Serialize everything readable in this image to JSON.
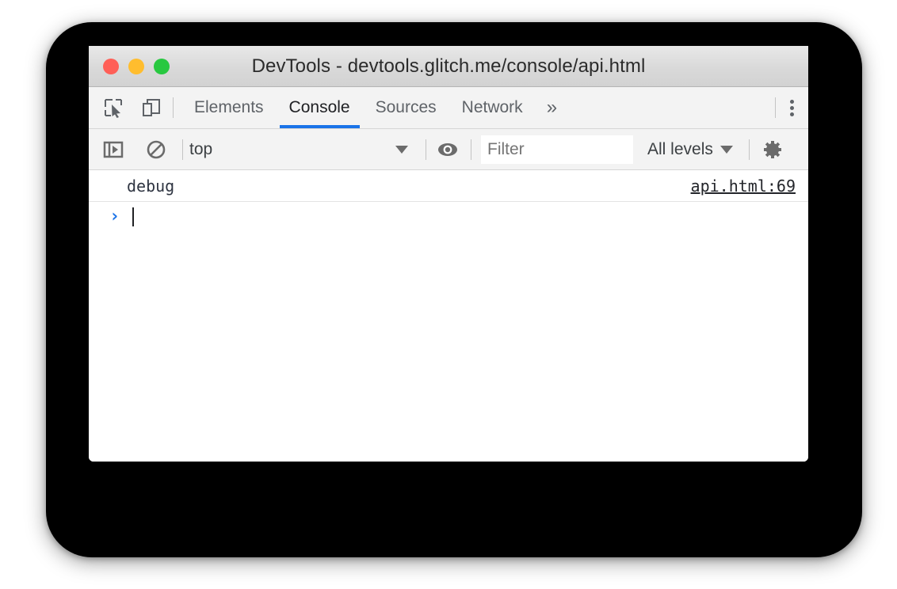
{
  "window": {
    "title": "DevTools - devtools.glitch.me/console/api.html",
    "traffic_lights": [
      {
        "name": "close",
        "color": "#ff5f57"
      },
      {
        "name": "minimize",
        "color": "#ffbd2e"
      },
      {
        "name": "zoom",
        "color": "#28c840"
      }
    ]
  },
  "tabbar": {
    "icons": [
      {
        "name": "inspect-element-icon"
      },
      {
        "name": "device-toolbar-icon"
      }
    ],
    "tabs": [
      {
        "label": "Elements",
        "active": false
      },
      {
        "label": "Console",
        "active": true
      },
      {
        "label": "Sources",
        "active": false
      },
      {
        "label": "Network",
        "active": false
      }
    ],
    "overflow_label": "»",
    "more_options_label": "⋮",
    "active_underline_color": "#1a73e8"
  },
  "console_toolbar": {
    "sidebar_toggle_name": "show-console-sidebar-icon",
    "clear_console_name": "clear-console-icon",
    "context_value": "top",
    "context_options": [
      "top"
    ],
    "live_expression_name": "eye-icon",
    "filter": {
      "value": "",
      "placeholder": "Filter"
    },
    "levels_label": "All levels",
    "settings_name": "gear-icon"
  },
  "console": {
    "messages": [
      {
        "text": "debug",
        "source": "api.html:69"
      }
    ],
    "prompt": {
      "chevron": "›",
      "input_value": ""
    }
  }
}
